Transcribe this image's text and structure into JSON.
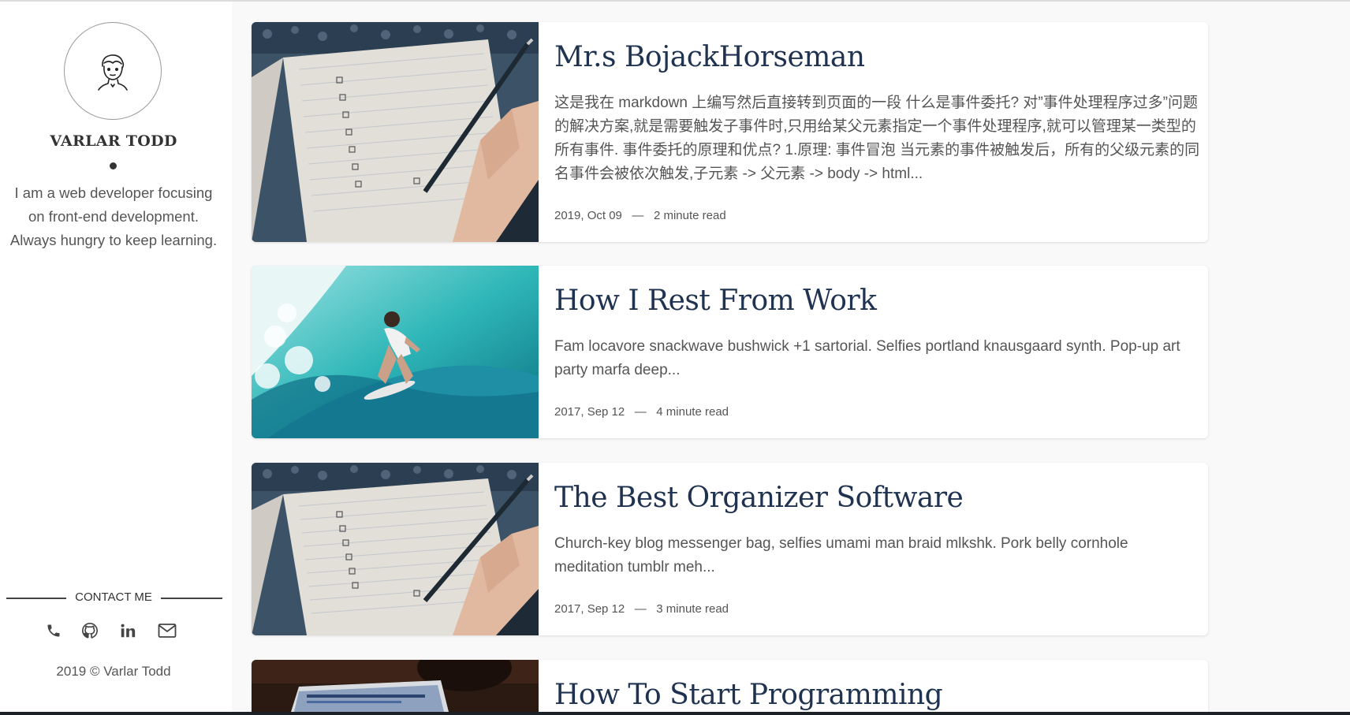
{
  "sidebar": {
    "author_name": "VARLAR TODD",
    "bio": "I am a web developer focusing on front-end development. Always hungry to keep learning.",
    "contact_label": "CONTACT ME",
    "contact_icons": [
      "phone-icon",
      "github-icon",
      "linkedin-icon",
      "mail-icon"
    ],
    "copyright": "2019 © Varlar Todd"
  },
  "posts": [
    {
      "title": "Mr.s BojackHorseman",
      "excerpt": "这是我在 markdown 上编写然后直接转到页面的一段 什么是事件委托? 对”事件处理程序过多”问题的解决方案,就是需要触发子事件时,只用给某父元素指定一个事件处理程序,就可以管理某一类型的所有事件. 事件委托的原理和优点? 1.原理: 事件冒泡 当元素的事件被触发后，所有的父级元素的同名事件会被依次触发,子元素 -> 父元素 -> body -> html...",
      "date": "2019, Oct 09",
      "separator": "—",
      "read_time": "2 minute read",
      "image": "notebook-pen-photo"
    },
    {
      "title": "How I Rest From Work",
      "excerpt": "Fam locavore snackwave bushwick +1 sartorial. Selfies portland knausgaard synth. Pop-up art party marfa deep...",
      "date": "2017, Sep 12",
      "separator": "—",
      "read_time": "4 minute read",
      "image": "surfer-wave-photo"
    },
    {
      "title": "The Best Organizer Software",
      "excerpt": "Church-key blog messenger bag, selfies umami man braid mlkshk. Pork belly cornhole meditation tumblr meh...",
      "date": "2017, Sep 12",
      "separator": "—",
      "read_time": "3 minute read",
      "image": "notebook-pen-photo"
    },
    {
      "title": "How To Start Programming",
      "image": "laptop-photo"
    }
  ],
  "colors": {
    "title": "#1f3350",
    "text": "#555555",
    "background": "#f9f9f9"
  }
}
